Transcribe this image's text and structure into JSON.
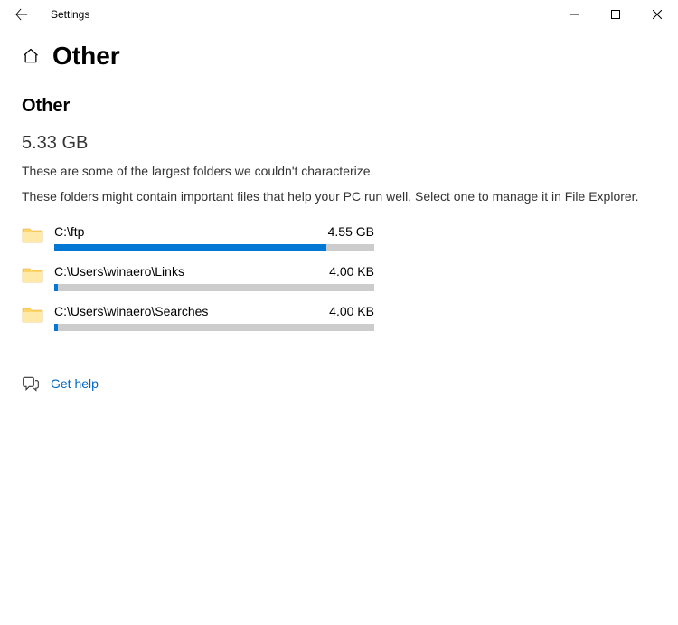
{
  "titlebar": {
    "title": "Settings"
  },
  "header": {
    "page_title": "Other"
  },
  "section": {
    "title": "Other",
    "total_size": "5.33 GB",
    "description1": "These are some of the largest folders we couldn't characterize.",
    "description2": "These folders might contain important files that help your PC run well. Select one to manage it in File Explorer."
  },
  "folders": [
    {
      "path": "C:\\ftp",
      "size": "4.55 GB",
      "fill_percent": 85
    },
    {
      "path": "C:\\Users\\winaero\\Links",
      "size": "4.00 KB",
      "fill_percent": 1
    },
    {
      "path": "C:\\Users\\winaero\\Searches",
      "size": "4.00 KB",
      "fill_percent": 1
    }
  ],
  "help": {
    "label": "Get help"
  }
}
